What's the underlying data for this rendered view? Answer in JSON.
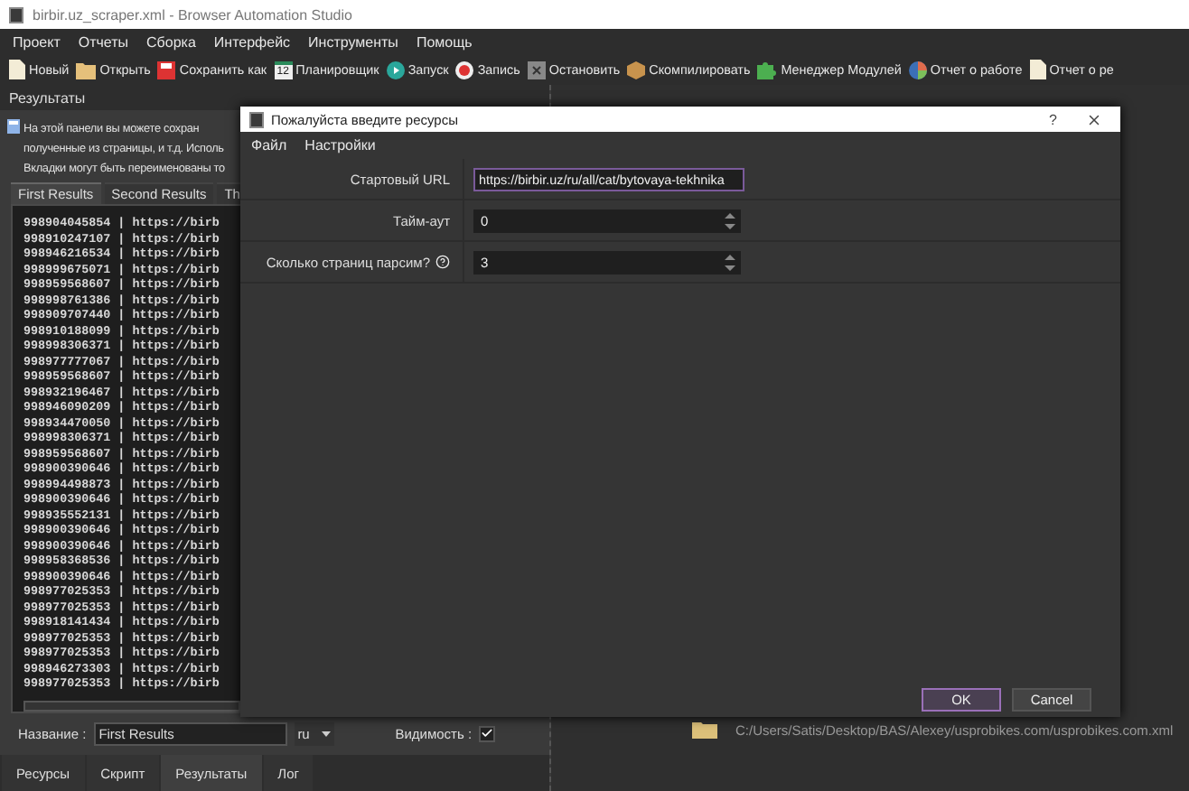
{
  "window": {
    "title": "birbir.uz_scraper.xml - Browser Automation Studio"
  },
  "menu": [
    "Проект",
    "Отчеты",
    "Сборка",
    "Интерфейс",
    "Инструменты",
    "Помощь"
  ],
  "toolbar": [
    {
      "kind": "new",
      "label": "Новый"
    },
    {
      "kind": "open",
      "label": "Открыть"
    },
    {
      "kind": "save",
      "label": "Сохранить как"
    },
    {
      "kind": "scheduler",
      "label": "Планировщик",
      "badge": "12"
    },
    {
      "kind": "run",
      "label": "Запуск"
    },
    {
      "kind": "record",
      "label": "Запись"
    },
    {
      "kind": "stop",
      "label": "Остановить"
    },
    {
      "kind": "compile",
      "label": "Скомпилировать"
    },
    {
      "kind": "modules",
      "label": "Менеджер Модулей"
    },
    {
      "kind": "report",
      "label": "Отчет о работе"
    },
    {
      "kind": "new",
      "label": "Отчет о ре"
    }
  ],
  "results_panel": {
    "title": "Результаты",
    "info_lines": [
      "На этой панели вы можете сохран",
      "полученные из страницы, и т.д. Исполь",
      "Вкладки могут быть переименованы то"
    ],
    "tabs": [
      {
        "label": "First Results",
        "selected": true
      },
      {
        "label": "Second Results",
        "selected": false
      },
      {
        "label": "Th",
        "selected": false
      }
    ],
    "rows": [
      "998904045854 | https://birb",
      "998910247107 | https://birb",
      "998946216534 | https://birb",
      "998999675071 | https://birb",
      "998959568607 | https://birb",
      "998998761386 | https://birb",
      "998909707440 | https://birb",
      "998910188099 | https://birb",
      "998998306371 | https://birb",
      "998977777067 | https://birb",
      "998959568607 | https://birb",
      "998932196467 | https://birb",
      "998946090209 | https://birb",
      "998934470050 | https://birb",
      "998998306371 | https://birb",
      "998959568607 | https://birb",
      "998900390646 | https://birb",
      "998994498873 | https://birb",
      "998900390646 | https://birb",
      "998935552131 | https://birb",
      "998900390646 | https://birb",
      "998900390646 | https://birb",
      "998958368536 | https://birb",
      "998900390646 | https://birb",
      "998977025353 | https://birb",
      "998977025353 | https://birb",
      "998918141434 | https://birb",
      "998977025353 | https://birb",
      "998977025353 | https://birb",
      "998946273303 | https://birb",
      "998977025353 | https://birb"
    ],
    "name_label": "Название :",
    "name_value": "First Results",
    "language": "ru",
    "visibility_label": "Видимость :",
    "visible": true
  },
  "bottom_tabs": [
    {
      "label": "Ресурсы",
      "selected": false
    },
    {
      "label": "Скрипт",
      "selected": false
    },
    {
      "label": "Результаты",
      "selected": true
    },
    {
      "label": "Лог",
      "selected": false
    }
  ],
  "recent_project": {
    "path": "C:/Users/Satis/Desktop/BAS/Alexey/usprobikes.com/usprobikes.com.xml"
  },
  "dialog": {
    "title": "Пожалуйста введите ресурсы",
    "help": "?",
    "menu": [
      "Файл",
      "Настройки"
    ],
    "fields": [
      {
        "kind": "text",
        "label": "Стартовый URL",
        "value": "https://birbir.uz/ru/all/cat/bytovaya-tekhnika",
        "focused": true
      },
      {
        "kind": "spin",
        "label": "Тайм-аут",
        "value": "0",
        "focused": false
      },
      {
        "kind": "spin",
        "label": "Сколько страниц парсим?",
        "value": "3",
        "focused": false,
        "has_help": true
      }
    ],
    "buttons": [
      {
        "label": "OK",
        "default": true
      },
      {
        "label": "Cancel",
        "default": false
      }
    ]
  }
}
